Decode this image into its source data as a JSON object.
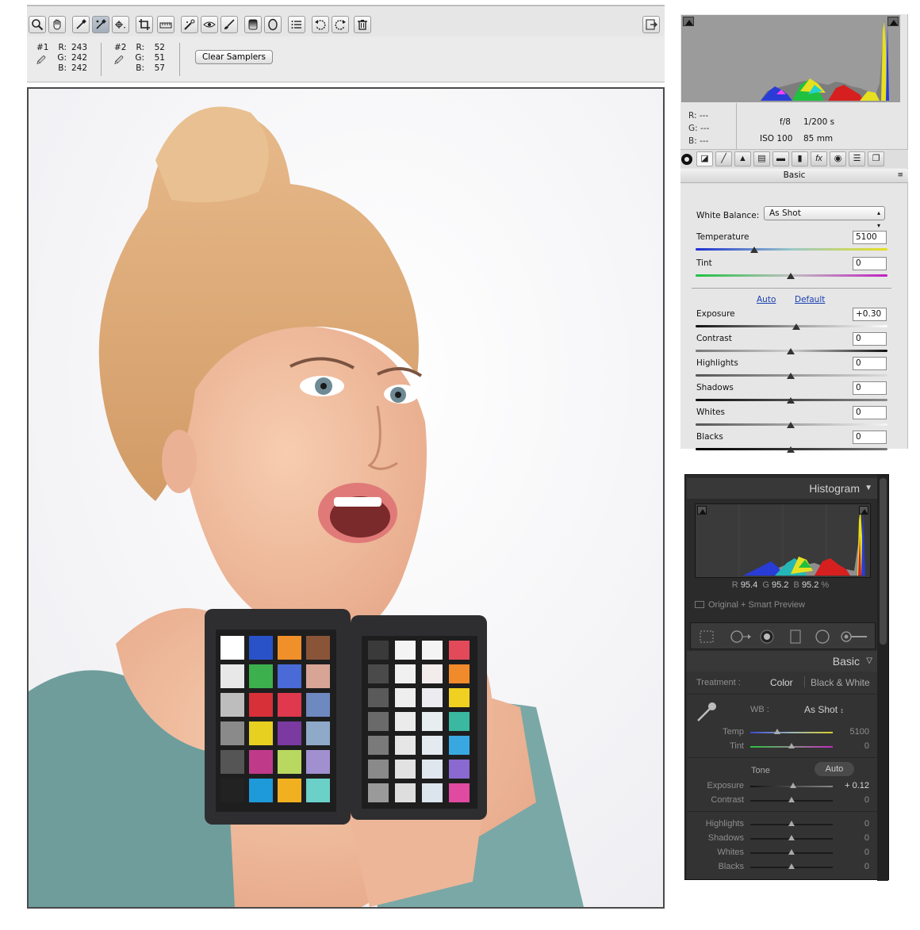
{
  "acr": {
    "toolbar": {
      "tools": [
        "zoom-tool",
        "hand-tool",
        "white-balance-tool",
        "color-sampler-tool",
        "targeted-adjustment-tool",
        "crop-tool",
        "straighten-tool",
        "spot-removal-tool",
        "red-eye-removal-tool",
        "adjustment-brush-tool",
        "graduated-filter-tool",
        "radial-filter-tool",
        "preferences-tool",
        "rotate-left-tool",
        "rotate-right-tool",
        "trash-tool"
      ],
      "active_tool": "color-sampler-tool"
    },
    "samplers": [
      {
        "num": "#1",
        "r_label": "R:",
        "r": "243",
        "g_label": "G:",
        "g": "242",
        "b_label": "B:",
        "b": "242"
      },
      {
        "num": "#2",
        "r_label": "R:",
        "r": "52",
        "g_label": "G:",
        "g": "51",
        "b_label": "B:",
        "b": "57"
      }
    ],
    "clear_samplers_label": "Clear Samplers",
    "info": {
      "r_label": "R:",
      "r": "---",
      "g_label": "G:",
      "g": "---",
      "b_label": "B:",
      "b": "---",
      "aperture": "f/8",
      "shutter": "1/200 s",
      "iso": "ISO 100",
      "focal": "85 mm"
    },
    "panel_title": "Basic",
    "white_balance_label": "White Balance:",
    "white_balance_value": "As Shot",
    "auto_label": "Auto",
    "default_label": "Default",
    "sliders": [
      {
        "label": "Temperature",
        "value": "5100"
      },
      {
        "label": "Tint",
        "value": "0"
      },
      {
        "label": "Exposure",
        "value": "+0.30"
      },
      {
        "label": "Contrast",
        "value": "0"
      },
      {
        "label": "Highlights",
        "value": "0"
      },
      {
        "label": "Shadows",
        "value": "0"
      },
      {
        "label": "Whites",
        "value": "0"
      },
      {
        "label": "Blacks",
        "value": "0"
      }
    ]
  },
  "lr": {
    "histogram_title": "Histogram",
    "rgb": {
      "r_label": "R",
      "r": "95.4",
      "g_label": "G",
      "g": "95.2",
      "b_label": "B",
      "b": "95.2",
      "unit": "%"
    },
    "smart_preview": "Original + Smart Preview",
    "basic_title": "Basic",
    "treatment_label": "Treatment :",
    "treatment_color": "Color",
    "treatment_bw": "Black & White",
    "wb_label": "WB :",
    "wb_value": "As Shot",
    "tone_label": "Tone",
    "auto_label": "Auto",
    "sliders": [
      {
        "label": "Temp",
        "value": "5100"
      },
      {
        "label": "Tint",
        "value": "0"
      },
      {
        "label": "Exposure",
        "value": "+ 0.12"
      },
      {
        "label": "Contrast",
        "value": "0"
      },
      {
        "label": "Highlights",
        "value": "0"
      },
      {
        "label": "Shadows",
        "value": "0"
      },
      {
        "label": "Whites",
        "value": "0"
      },
      {
        "label": "Blacks",
        "value": "0"
      }
    ]
  },
  "colors": {
    "acr_bg": "#e6e6e6",
    "lr_bg": "#2b2b2b",
    "link": "#1a3fb0"
  }
}
